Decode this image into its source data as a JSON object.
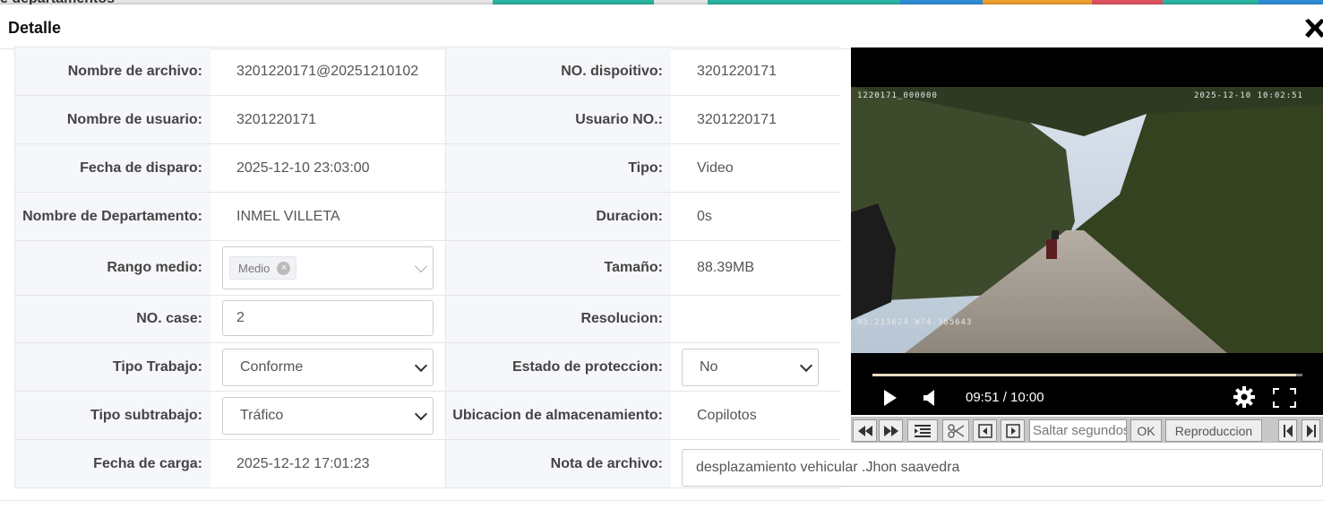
{
  "background": {
    "partial_text": "e departamentos"
  },
  "modal": {
    "title": "Detalle"
  },
  "rows": [
    {
      "label": "Nombre de archivo:",
      "value": "3201220171@20251210102",
      "label2": "NO. dispoitivo:",
      "value2": "3201220171"
    },
    {
      "label": "Nombre de usuario:",
      "value": "3201220171",
      "label2": "Usuario NO.:",
      "value2": "3201220171"
    },
    {
      "label": "Fecha de disparo:",
      "value": "2025-12-10 23:03:00",
      "label2": "Tipo:",
      "value2": "Video"
    },
    {
      "label": "Nombre de Departamento:",
      "value": "INMEL VILLETA",
      "label2": "Duracion:",
      "value2": "0s"
    },
    {
      "label": "Rango medio:",
      "tag": "Medio",
      "label2": "Tamaño:",
      "value2": "88.39MB"
    },
    {
      "label": "NO. case:",
      "input_value": "2",
      "label2": "Resolucion:",
      "value2": ""
    },
    {
      "label": "Tipo Trabajo:",
      "select_value": "Conforme",
      "label2": "Estado de proteccion:",
      "select2_value": "No"
    },
    {
      "label": "Tipo subtrabajo:",
      "select_value": "Tráfico",
      "label2": "Ubicacion de almacenamiento:",
      "value2": "Copilotos"
    },
    {
      "label": "Fecha de carga:",
      "value": "2025-12-12 17:01:23",
      "label2": "Nota de archivo:",
      "note_value": "desplazamiento vehicular .Jhon saavedra"
    }
  ],
  "video": {
    "osd_top_left": "1220171_000000",
    "osd_top_right": "2025-12-10 10:02:51",
    "osd_gps": "N5.213624 W74.385643",
    "time_display": "09:51 / 10:00",
    "progress": 0.985
  },
  "toolbar": {
    "seek_placeholder": "Saltar segundos",
    "ok_label": "OK",
    "playback_label": "Reproduccion"
  },
  "colors": {
    "accent": "#e9dcc0",
    "label_bg": "#f5f7fa"
  }
}
